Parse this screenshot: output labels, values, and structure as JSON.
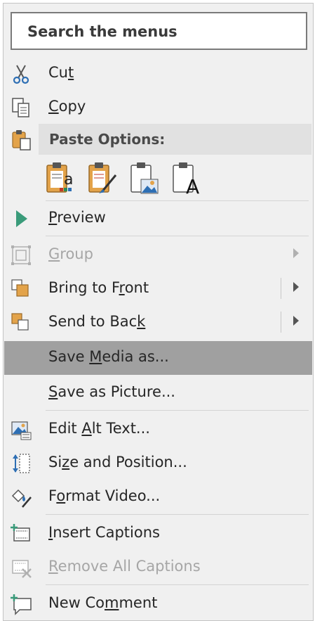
{
  "search": {
    "label": "Search the menus"
  },
  "menu": {
    "cut": {
      "pre": "Cu",
      "key": "t",
      "post": "",
      "icon": "scissors-icon"
    },
    "copy": {
      "pre": "",
      "key": "C",
      "post": "opy",
      "icon": "copy-icon"
    },
    "paste_options": {
      "label": "Paste Options:",
      "icon": "clipboard-icon"
    },
    "paste_buttons": [
      {
        "name": "paste-use-destination-theme",
        "letter": "a"
      },
      {
        "name": "paste-keep-source-formatting",
        "letter": ""
      },
      {
        "name": "paste-as-picture",
        "letter": ""
      },
      {
        "name": "paste-keep-text-only",
        "letter": "A"
      }
    ],
    "preview": {
      "pre": "",
      "key": "P",
      "post": "review",
      "icon": "play-icon"
    },
    "group": {
      "pre": "",
      "key": "G",
      "post": "roup",
      "icon": "group-icon",
      "disabled": true
    },
    "bring_to_front": {
      "pre": "Bring to F",
      "key": "r",
      "post": "ont",
      "icon": "bring-to-front-icon"
    },
    "send_to_back": {
      "pre": "Send to Bac",
      "key": "k",
      "post": "",
      "icon": "send-to-back-icon"
    },
    "save_media_as": {
      "pre": "Save ",
      "key": "M",
      "post": "edia as...",
      "highlighted": true
    },
    "save_as_picture": {
      "pre": "",
      "key": "S",
      "post": "ave as Picture..."
    },
    "edit_alt_text": {
      "pre": "Edit ",
      "key": "A",
      "post": "lt Text...",
      "icon": "alt-text-icon"
    },
    "size_and_position": {
      "pre": "Si",
      "key": "z",
      "post": "e and Position...",
      "icon": "size-position-icon"
    },
    "format_video": {
      "pre": "F",
      "key": "o",
      "post": "rmat Video...",
      "icon": "format-video-icon"
    },
    "insert_captions": {
      "pre": "",
      "key": "I",
      "post": "nsert Captions",
      "icon": "insert-captions-icon"
    },
    "remove_all_captions": {
      "pre": "",
      "key": "R",
      "post": "emove All Captions",
      "icon": "remove-captions-icon",
      "disabled": true
    },
    "new_comment": {
      "pre": "New Co",
      "key": "m",
      "post": "ment",
      "icon": "new-comment-icon"
    }
  },
  "colors": {
    "highlight": "#a0a0a0",
    "accent_green": "#3a9b7a",
    "disabled_text": "#a6a6a6"
  }
}
